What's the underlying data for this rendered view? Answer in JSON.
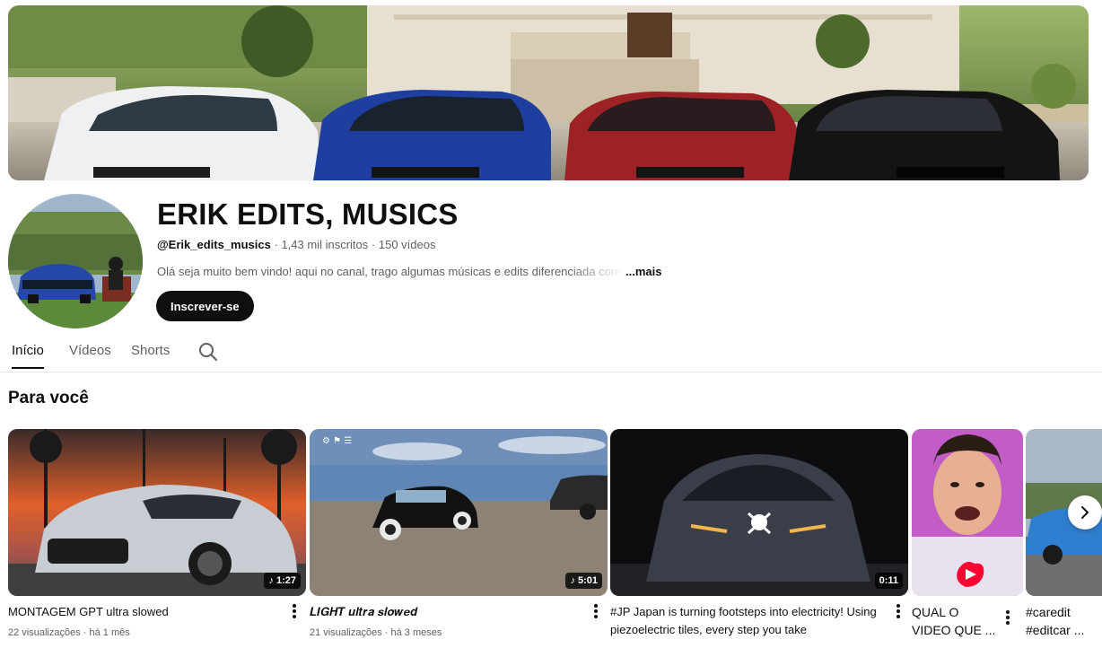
{
  "channel": {
    "name": "ERIK EDITS, MUSICS",
    "handle": "@Erik_edits_musics",
    "subscribers": "1,43 mil inscritos",
    "videos_count": "150 vídeos",
    "separator": "·",
    "description": "Olá seja muito bem vindo! aqui no canal, trago algumas músicas e edits diferenciada com",
    "more_label": "...mais",
    "subscribe_label": "Inscrever-se"
  },
  "tabs": [
    {
      "label": "Início",
      "active": true
    },
    {
      "label": "Vídeos",
      "active": false
    },
    {
      "label": "Shorts",
      "active": false
    }
  ],
  "section": {
    "title": "Para você"
  },
  "videos": [
    {
      "title": "MONTAGEM GPT ultra slowed",
      "views": "22 visualizações",
      "age": "há 1 mês",
      "duration": "1:27",
      "music": true
    },
    {
      "title": "𝑳𝑰𝑮𝑯𝑻 𝒖𝒍𝒕𝒓𝒂 𝒔𝒍𝒐𝒘𝒆𝒅",
      "views": "21 visualizações",
      "age": "há 3 meses",
      "duration": "5:01",
      "music": true
    },
    {
      "title_line1": "#JP Japan is turning footsteps into electricity! Using",
      "title_line2": "piezoelectric tiles, every step you take",
      "duration": "0:11",
      "music": false
    },
    {
      "title_line1": "QUAL O",
      "title_line2": "VIDEO QUE ..."
    },
    {
      "title_line1": "#caredit",
      "title_line2": "#editcar ..."
    }
  ],
  "colors": {
    "accent": "#0f0f0f",
    "secondary_text": "#606060",
    "shorts_red": "#ff0033"
  }
}
